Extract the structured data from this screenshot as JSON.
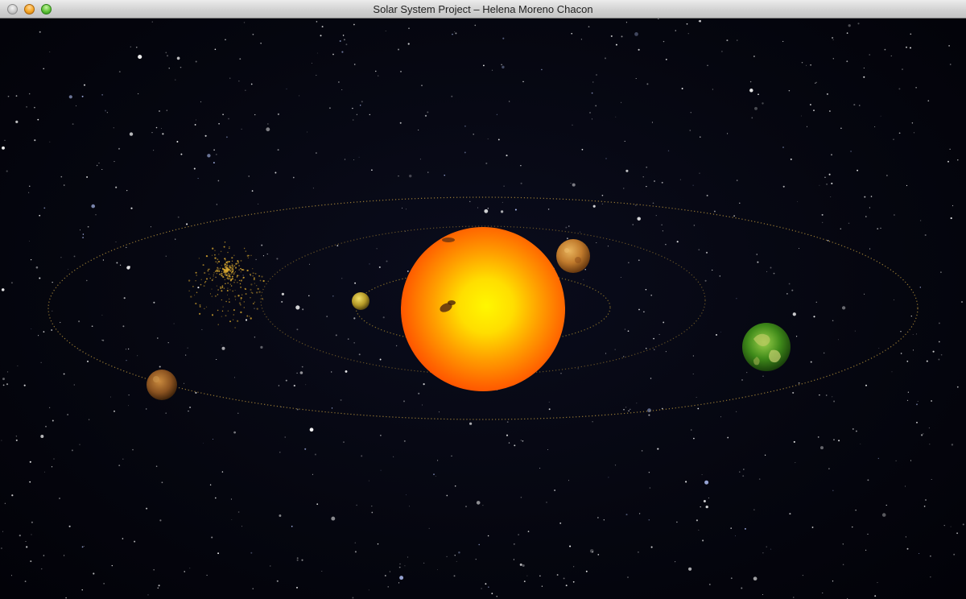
{
  "window": {
    "title": "Solar System Project – Helena Moreno Chacon"
  },
  "icons": {
    "close": "close-button-icon",
    "minimize": "minimize-button-icon",
    "maximize": "zoom-button-icon"
  },
  "colors": {
    "space": "#05060f",
    "orbit": "#c8a040",
    "sun_core": "#fff000",
    "sun_edge": "#ff5a00",
    "asteroid": "#d9a830"
  }
}
